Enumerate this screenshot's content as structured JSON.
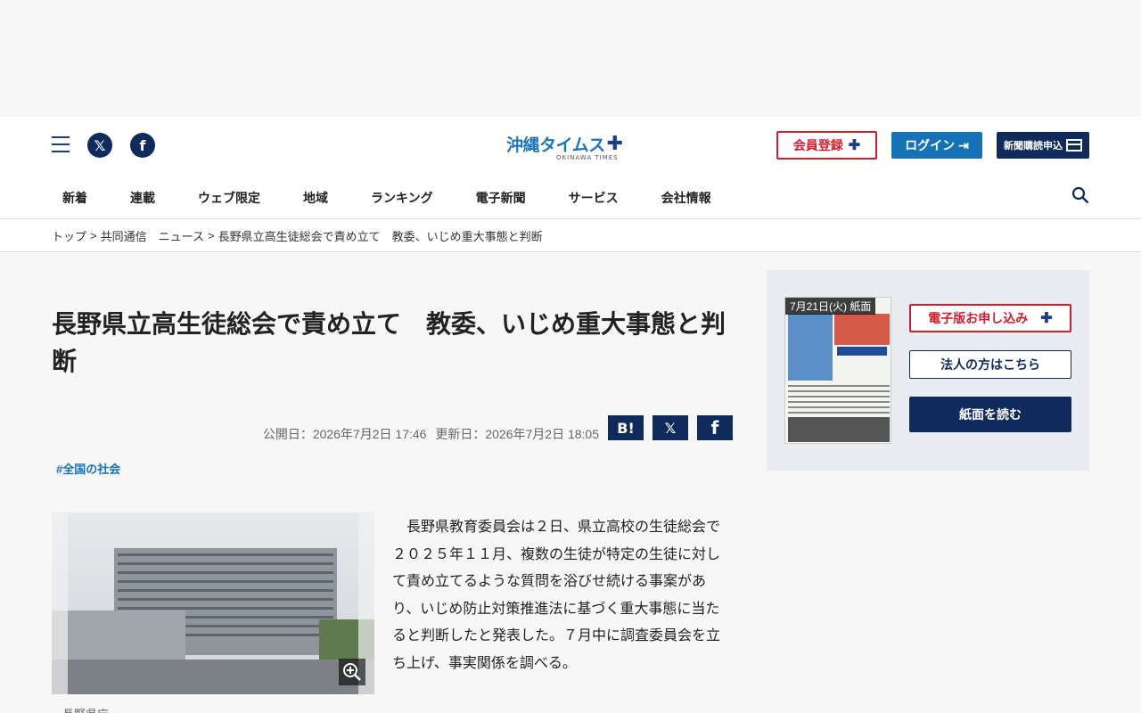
{
  "header": {
    "logo_text": "沖縄タイムス",
    "logo_sub": "OKINAWA TIMES",
    "register_label": "会員登録",
    "login_label": "ログイン",
    "subscribe_label": "新聞購読申込"
  },
  "nav": {
    "items": [
      "新着",
      "連載",
      "ウェブ限定",
      "地域",
      "ランキング",
      "電子新聞",
      "サービス",
      "会社情報"
    ]
  },
  "breadcrumb": {
    "top": "トップ",
    "section": "共同通信　ニュース",
    "current": "長野県立高生徒総会で責め立て　教委、いじめ重大事態と判断"
  },
  "article": {
    "title": "長野県立高生徒総会で責め立て　教委、いじめ重大事態と判断",
    "published": "公開日：2026年7月2日 17:46",
    "updated": "更新日：2026年7月2日 18:05",
    "tag": "#全国の社会",
    "body": "　長野県教育委員会は２日、県立高校の生徒総会で２０２５年１１月、複数の生徒が特定の生徒に対して責め立てるような質問を浴びせ続ける事案があり、いじめ防止対策推進法に基づく重大事態に当たると判断したと発表した。７月中に調査委員会を立ち上げ、事実関係を調べる。",
    "caption": "長野県庁"
  },
  "sidebar": {
    "paper_date": "7月21日(火) 紙面",
    "digital_label": "電子版お申し込み",
    "corp_label": "法人の方はこちら",
    "read_label": "紙面を読む"
  }
}
